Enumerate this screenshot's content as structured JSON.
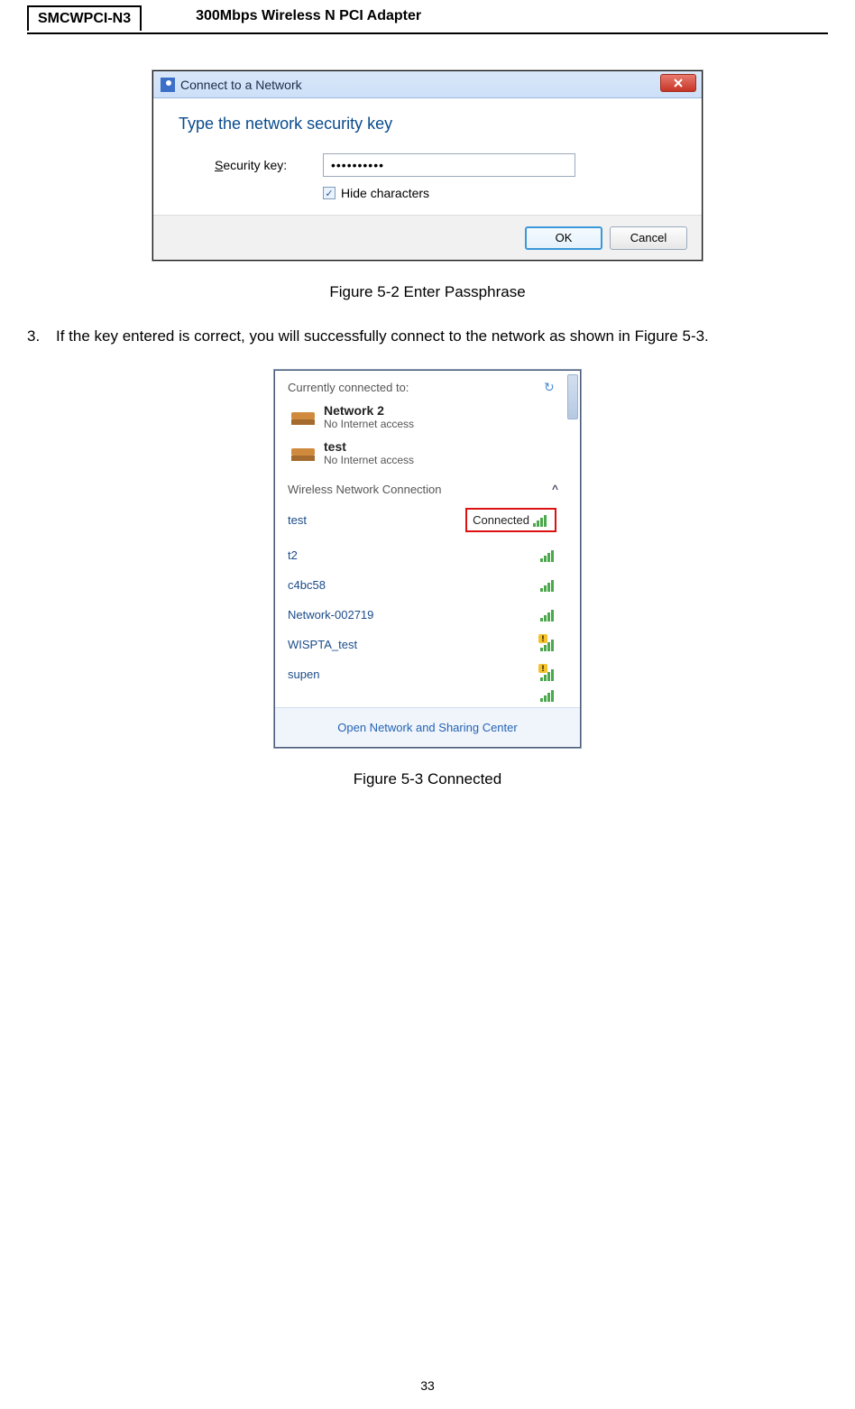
{
  "header": {
    "left": "SMCWPCI-N3",
    "right": "300Mbps Wireless N PCI Adapter"
  },
  "dialog": {
    "title": "Connect to a Network",
    "heading": "Type the network security key",
    "security_label": "Security key:",
    "security_value": "••••••••••",
    "hide_label": "Hide characters",
    "ok": "OK",
    "cancel": "Cancel"
  },
  "caption1": "Figure 5-2 Enter Passphrase",
  "step": {
    "num": "3.",
    "text": "If the key entered is correct, you will successfully connect to the network as shown in Figure 5-3."
  },
  "flyout": {
    "header": "Currently connected to:",
    "nets": [
      {
        "name": "Network  2",
        "status": "No Internet access"
      },
      {
        "name": "test",
        "status": "No Internet access"
      }
    ],
    "section": "Wireless Network Connection",
    "connected_label": "Connected",
    "items": [
      {
        "name": "test",
        "connected": true,
        "warn": false
      },
      {
        "name": "t2",
        "connected": false,
        "warn": false
      },
      {
        "name": "c4bc58",
        "connected": false,
        "warn": false
      },
      {
        "name": "Network-002719",
        "connected": false,
        "warn": false
      },
      {
        "name": "WISPTA_test",
        "connected": false,
        "warn": true
      },
      {
        "name": "supen",
        "connected": false,
        "warn": true
      }
    ],
    "footer": "Open Network and Sharing Center"
  },
  "caption2": "Figure 5-3 Connected",
  "page_number": "33"
}
